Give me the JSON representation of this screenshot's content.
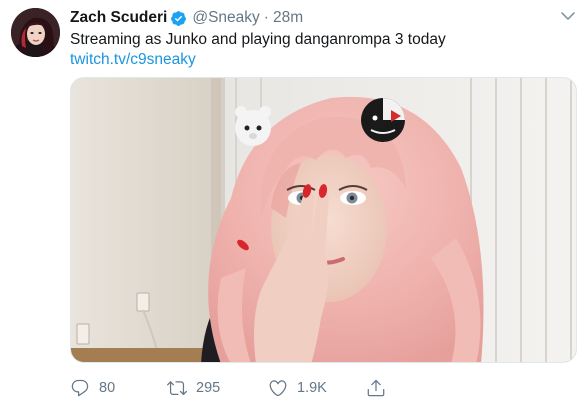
{
  "tweet": {
    "author_name": "Zach Scuderi",
    "handle": "@Sneaky",
    "separator": "·",
    "time": "28m",
    "text": "Streaming as Junko and playing danganrompa 3 today",
    "link_text": "twitch.tv/c9sneaky"
  },
  "actions": {
    "reply_count": "80",
    "retweet_count": "295",
    "like_count": "1.9K"
  },
  "colors": {
    "link": "#1b95e0",
    "verified": "#1da1f2",
    "muted": "#657786"
  },
  "icons": {
    "verified": "verified-badge-icon",
    "caret": "chevron-down-icon",
    "reply": "reply-icon",
    "retweet": "retweet-icon",
    "like": "heart-icon",
    "share": "share-icon"
  }
}
